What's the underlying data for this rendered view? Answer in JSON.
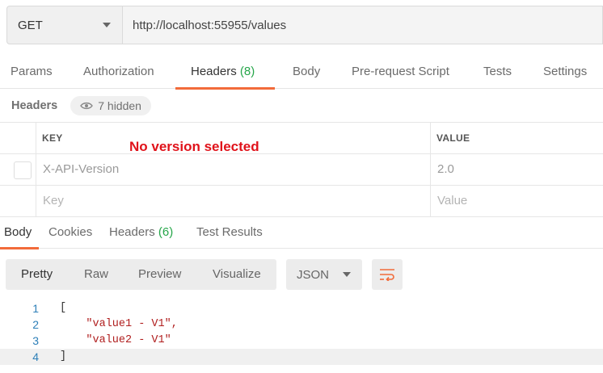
{
  "request": {
    "method": "GET",
    "url": "http://localhost:55955/values"
  },
  "request_tabs": [
    {
      "label": "Params"
    },
    {
      "label": "Authorization"
    },
    {
      "label": "Headers",
      "count": "(8)",
      "active": true
    },
    {
      "label": "Body"
    },
    {
      "label": "Pre-request Script"
    },
    {
      "label": "Tests"
    },
    {
      "label": "Settings"
    }
  ],
  "headers_section": {
    "title": "Headers",
    "hidden_label": "7 hidden",
    "columns": {
      "key": "KEY",
      "value": "VALUE"
    },
    "rows": [
      {
        "key": "X-API-Version",
        "value": "2.0",
        "checked": false
      }
    ],
    "placeholder": {
      "key": "Key",
      "value": "Value"
    }
  },
  "annotation": "No version selected",
  "response_tabs": [
    {
      "label": "Body",
      "active": true
    },
    {
      "label": "Cookies"
    },
    {
      "label": "Headers",
      "count": "(6)"
    },
    {
      "label": "Test Results"
    }
  ],
  "body_toolbar": {
    "formats": [
      "Pretty",
      "Raw",
      "Preview",
      "Visualize"
    ],
    "active_format": "Pretty",
    "language": "JSON",
    "wrap_icon": "wrap-lines-icon"
  },
  "response_body": {
    "lines": [
      {
        "n": "1",
        "text": "["
      },
      {
        "n": "2",
        "text": "    \"value1 - V1\","
      },
      {
        "n": "3",
        "text": "    \"value2 - V1\""
      },
      {
        "n": "4",
        "text": "]"
      }
    ]
  },
  "colors": {
    "accent": "#f26b3a",
    "count_green": "#26a64a",
    "annotation_red": "#e0121a",
    "string_red": "#b01e1e",
    "line_number_blue": "#2d7fb8"
  }
}
